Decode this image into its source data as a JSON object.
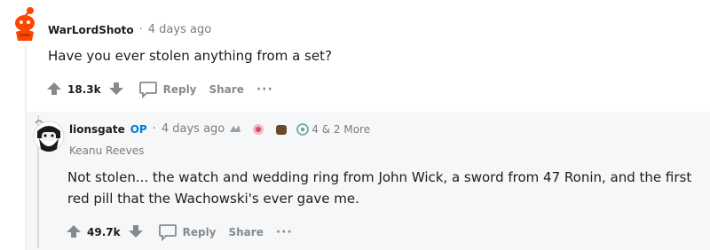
{
  "comment": {
    "username": "WarLordShoto",
    "time": "4 days ago",
    "text": "Have you ever stolen anything from a set?",
    "votes": "18.3k",
    "reply_label": "Reply",
    "share_label": "Share",
    "more_label": "···"
  },
  "reply": {
    "username": "lionsgate",
    "op_badge": "OP",
    "time": "4 days ago",
    "awards_more": "4 & 2 More",
    "flair": "Keanu Reeves",
    "text_line1": "Not stolen... the watch and wedding ring from John Wick, a sword from 47 Ronin, and the first",
    "text_line2": "red pill that the Wachowski's ever gave me.",
    "votes": "49.7k",
    "reply_label": "Reply",
    "share_label": "Share",
    "more_label": "···"
  },
  "colors": {
    "op_blue": "#0079d3",
    "snoo_orange": "#ff4500",
    "reply_bg": "#f6f7f8",
    "meta_gray": "#7c7c7c"
  },
  "icons": [
    "snoo-avatar-icon",
    "upvote-icon",
    "downvote-icon",
    "comment-bubble-icon",
    "bearded-avatar-icon",
    "award-icons"
  ]
}
